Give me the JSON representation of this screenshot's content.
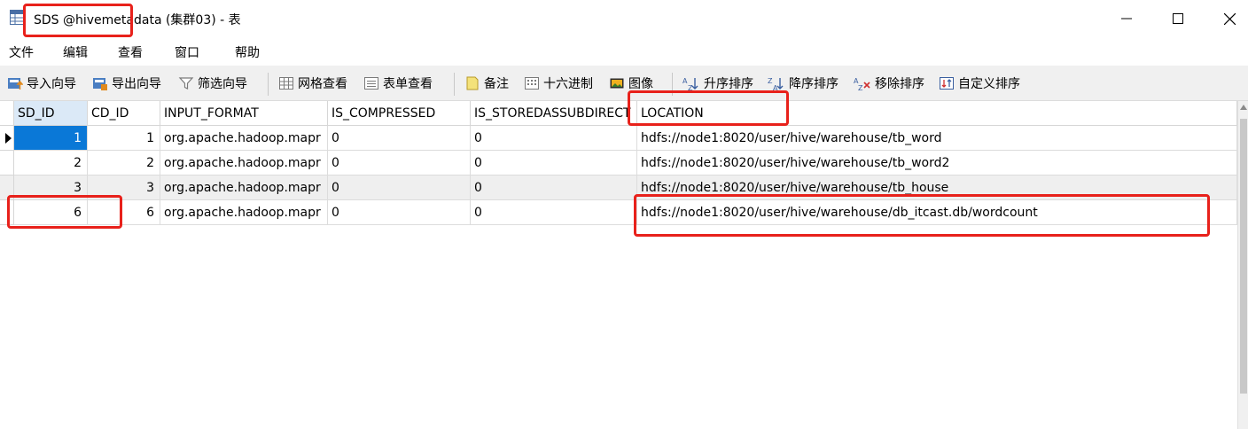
{
  "window": {
    "title": "SDS @hivemetadata (集群03) - 表"
  },
  "menu": {
    "items": [
      "文件",
      "编辑",
      "查看",
      "窗口",
      "帮助"
    ]
  },
  "toolbar": {
    "import_wizard": "导入向导",
    "export_wizard": "导出向导",
    "filter_wizard": "筛选向导",
    "grid_view": "网格查看",
    "form_view": "表单查看",
    "memo": "备注",
    "hex": "十六进制",
    "image": "图像",
    "sort_asc": "升序排序",
    "sort_desc": "降序排序",
    "remove_sort": "移除排序",
    "custom_sort": "自定义排序"
  },
  "table": {
    "columns": [
      "SD_ID",
      "CD_ID",
      "INPUT_FORMAT",
      "IS_COMPRESSED",
      "IS_STOREDASSUBDIRECT",
      "LOCATION"
    ],
    "rows": [
      [
        "1",
        "1",
        "org.apache.hadoop.mapr",
        "0",
        "0",
        "hdfs://node1:8020/user/hive/warehouse/tb_word"
      ],
      [
        "2",
        "2",
        "org.apache.hadoop.mapr",
        "0",
        "0",
        "hdfs://node1:8020/user/hive/warehouse/tb_word2"
      ],
      [
        "3",
        "3",
        "org.apache.hadoop.mapr",
        "0",
        "0",
        "hdfs://node1:8020/user/hive/warehouse/tb_house"
      ],
      [
        "6",
        "6",
        "org.apache.hadoop.mapr",
        "0",
        "0",
        "hdfs://node1:8020/user/hive/warehouse/db_itcast.db/wordcount"
      ]
    ],
    "selected_row": 0
  },
  "colors": {
    "annotation": "#e8211b",
    "selection": "#0a78d7",
    "header_selected": "#dbe9f7"
  }
}
